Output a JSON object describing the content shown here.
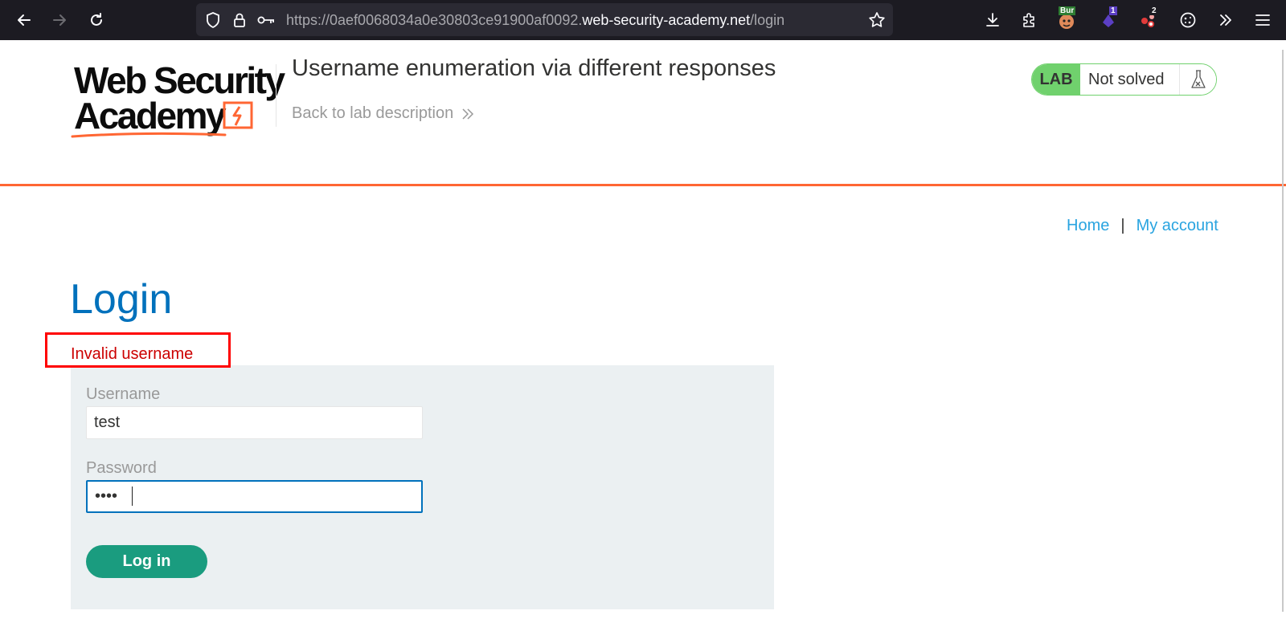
{
  "browser": {
    "url_prefix": "https://0aef0068034a0e30803ce91900af0092.",
    "url_host": "web-security-academy.net",
    "url_path": "/login",
    "extensions": [
      {
        "name": "burp-extension",
        "badge": "Bur"
      },
      {
        "name": "extension-2",
        "badge": "1"
      },
      {
        "name": "extension-3",
        "badge": "2"
      }
    ]
  },
  "header": {
    "logo_line1": "Web Security",
    "logo_line2": "Academy",
    "lab_title": "Username enumeration via different responses",
    "back_link": "Back to lab description",
    "lab_badge": "LAB",
    "lab_status": "Not solved"
  },
  "nav": {
    "home": "Home",
    "separator": "|",
    "my_account": "My account"
  },
  "login": {
    "heading": "Login",
    "error": "Invalid username",
    "username_label": "Username",
    "username_value": "test",
    "password_label": "Password",
    "password_value": "test",
    "submit_label": "Log in"
  },
  "colors": {
    "accent_orange": "#ff6633",
    "heading_blue": "#0071bc",
    "link_blue": "#29a4e0",
    "lab_green": "#70d16d",
    "button_green": "#1a9c7f",
    "error_red": "#cc0000"
  }
}
